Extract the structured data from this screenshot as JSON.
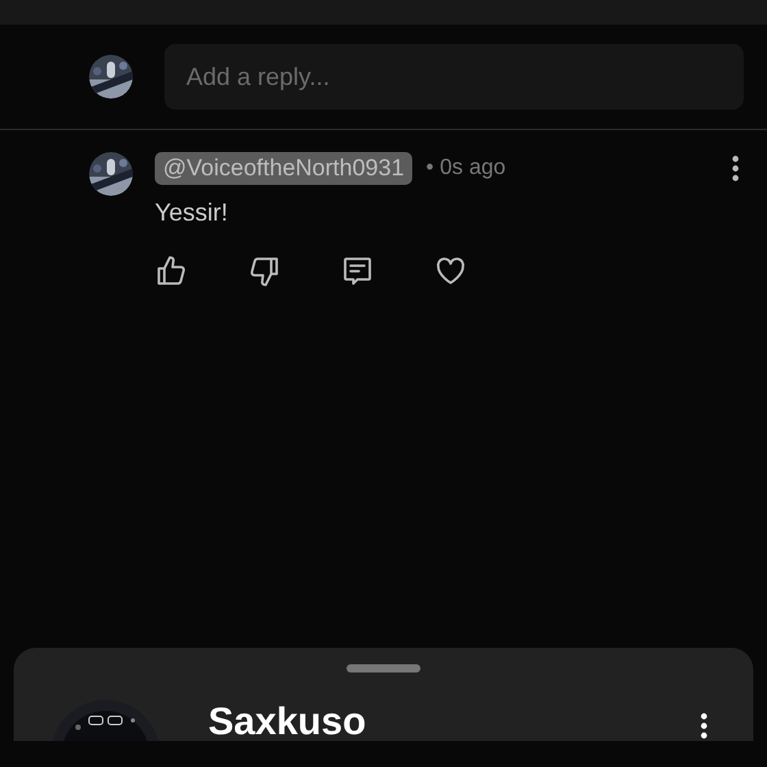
{
  "reply_box": {
    "placeholder": "Add a reply..."
  },
  "comment": {
    "author": "@VoiceoftheNorth0931",
    "time": "• 0s ago",
    "text": "Yessir!",
    "liked": false,
    "disliked": false,
    "hearted": false
  },
  "sheet": {
    "channel_name": "Saxkuso"
  }
}
